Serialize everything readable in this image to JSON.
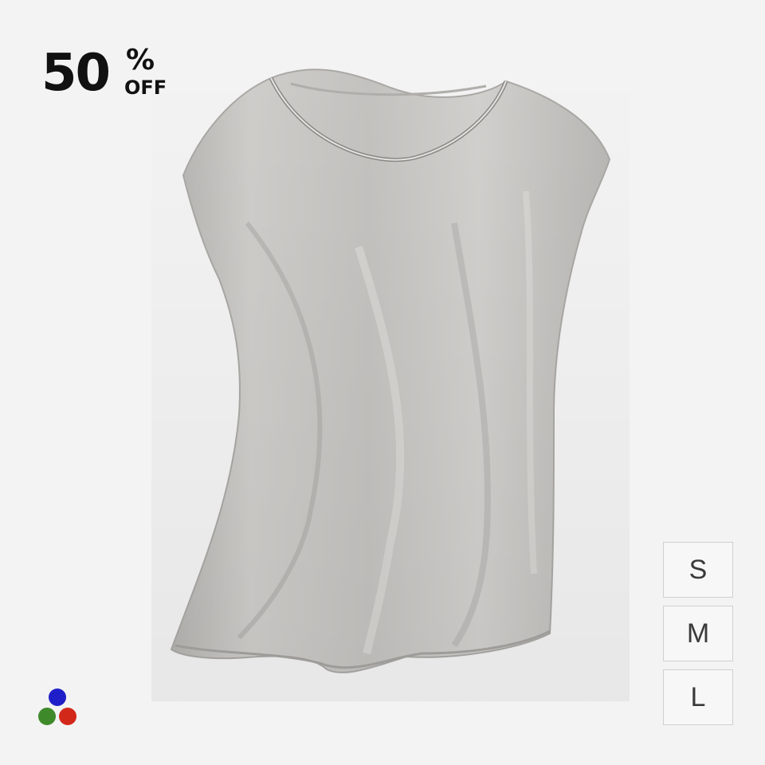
{
  "discount": {
    "number": "50",
    "percent": "%",
    "off": "OFF"
  },
  "product": {
    "image_icon": "sleeveless-top-image",
    "garment_color": "#c3c1be"
  },
  "color_options": [
    {
      "name": "blue",
      "color": "#1f1fc9"
    },
    {
      "name": "green",
      "color": "#3e8a2a"
    },
    {
      "name": "red",
      "color": "#d2281a"
    }
  ],
  "sizes": [
    "S",
    "M",
    "L"
  ]
}
